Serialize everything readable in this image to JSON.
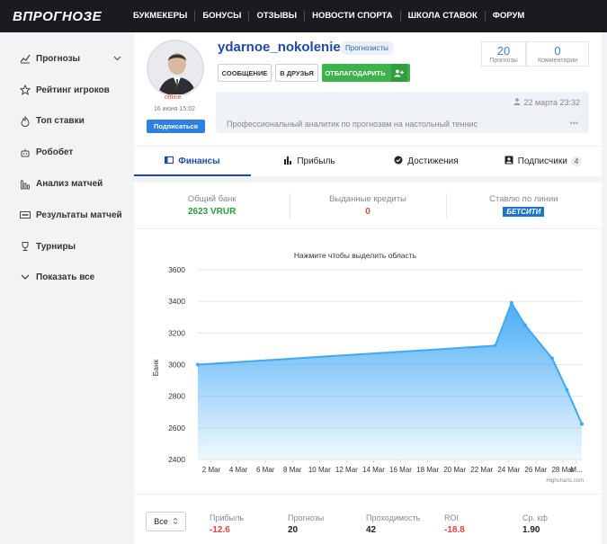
{
  "header": {
    "logo": "ВПРОГНОЗЕ",
    "nav": [
      "БУКМЕКЕРЫ",
      "БОНУСЫ",
      "ОТЗЫВЫ",
      "НОВОСТИ СПОРТА",
      "ШКОЛА СТАВОК",
      "ФОРУМ"
    ]
  },
  "sidebar": {
    "items": [
      {
        "label": "Прогнозы",
        "icon": "trend-line-icon",
        "has_chevron": true
      },
      {
        "label": "Рейтинг игроков",
        "icon": "star-icon"
      },
      {
        "label": "Топ ставки",
        "icon": "fire-icon"
      },
      {
        "label": "Робобет",
        "icon": "robot-icon"
      },
      {
        "label": "Анализ матчей",
        "icon": "bar-chart-icon"
      },
      {
        "label": "Результаты матчей",
        "icon": "live-icon"
      },
      {
        "label": "Турниры",
        "icon": "trophy-icon"
      },
      {
        "label": "Показать все",
        "icon": "chevron-down-icon"
      }
    ]
  },
  "profile": {
    "username": "ydarnoe_nokolenie",
    "role": "Прогнозисты",
    "status": "offline",
    "registered": "16 июня 15:02",
    "subscribe_label": "Подписаться",
    "message_label": "СООБЩЕНИЕ",
    "friend_label": "В ДРУЗЬЯ",
    "thank_label": "ОТБЛАГОДАРИТЬ",
    "stats": [
      {
        "value": "20",
        "label": "Прогнозы"
      },
      {
        "value": "0",
        "label": "Комментарии"
      }
    ],
    "bio_date": "22 марта 23:32",
    "bio": "Профессиональный аналитик по прогнозам на настольный теннис",
    "bio_more": "•••"
  },
  "tabs": [
    {
      "label": "Финансы",
      "icon": "wallet-icon",
      "active": true
    },
    {
      "label": "Прибыль",
      "icon": "bars-icon"
    },
    {
      "label": "Достижения",
      "icon": "badge-check-icon"
    },
    {
      "label": "Подписчики",
      "icon": "subscribers-icon",
      "count": "4"
    }
  ],
  "finance": {
    "bank_label": "Общий банк",
    "bank_value": "2623 VRUR",
    "credits_label": "Выданные кредиты",
    "credits_value": "0",
    "line_label": "Ставлю по линии",
    "bookmaker": "БЕТСИТИ"
  },
  "chart_data": {
    "type": "area",
    "title": "Нажмите чтобы выделить область",
    "xlabel": "",
    "ylabel": "Банк",
    "ylim": [
      2400,
      3600
    ],
    "yticks": [
      2400,
      2600,
      2800,
      3000,
      3200,
      3400,
      3600
    ],
    "x_range": [
      0,
      28.4
    ],
    "x": [
      0,
      22,
      23.2,
      24.2,
      26.2,
      27.3,
      28.4
    ],
    "y": [
      3000,
      3120,
      3390,
      3250,
      3040,
      2840,
      2625
    ],
    "xtick_positions": [
      1,
      3,
      5,
      7,
      9,
      11,
      13,
      15,
      17,
      19,
      21,
      23,
      25,
      27,
      28
    ],
    "xtick_labels": [
      "2 Mar",
      "4 Mar",
      "6 Mar",
      "8 Mar",
      "10 Mar",
      "12 Mar",
      "14 Mar",
      "16 Mar",
      "18 Mar",
      "20 Mar",
      "22 Mar",
      "24 Mar",
      "26 Mar",
      "28 Mar",
      "M..."
    ],
    "credits": "Highcharts.com",
    "color": "#41a8f5",
    "grid": true
  },
  "footer": {
    "period": "Все",
    "stats": [
      {
        "label": "Прибыль",
        "value": "-12.6",
        "color": "red"
      },
      {
        "label": "Прогнозы",
        "value": "20"
      },
      {
        "label": "Проходимость",
        "value": "42"
      },
      {
        "label": "ROI",
        "value": "-18.8",
        "color": "red"
      },
      {
        "label": "Ср. кф",
        "value": "1.90"
      }
    ]
  }
}
